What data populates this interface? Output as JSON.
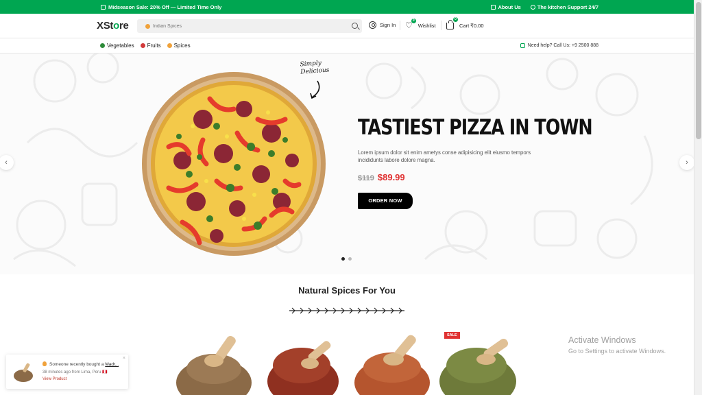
{
  "topbar": {
    "promo_text": "Midseason Sale: 20% Off — Limited Time Only",
    "about_label": "About Us",
    "support_label": "The kitchen Support 24/7"
  },
  "header": {
    "logo_main": "XSt",
    "logo_accent": "o",
    "logo_end": "re",
    "search_placeholder": "Indian Spices",
    "signin_label": "Sign In",
    "wishlist_label": "Wishlist",
    "wishlist_count": "0",
    "cart_label": "Cart",
    "cart_amount": "₹0.00",
    "cart_count": "0"
  },
  "nav": {
    "categories": [
      {
        "label": "Vegetables",
        "color": "#2e8b3a"
      },
      {
        "label": "Fruits",
        "color": "#d23b3b"
      },
      {
        "label": "Spices",
        "color": "#f0a23b"
      }
    ],
    "help_text": "Need help? Call Us: +9 2500 888"
  },
  "hero": {
    "handwritten_line1": "Simply",
    "handwritten_line2": "Delicious",
    "title": "TASTIEST PIZZA IN TOWN",
    "description": "Lorem ipsum dolor sit enim ametys conse adipisicing elit eiusmo tempors incididunts labore dolore magna.",
    "old_price": "$119",
    "new_price": "$89.99",
    "cta_label": "ORDER NOW",
    "slides_total": 2,
    "active_slide": 1
  },
  "section": {
    "title": "Natural Spices For You"
  },
  "products": [
    {
      "name": "cumin-powder",
      "color": "#8b6a47",
      "sale": false
    },
    {
      "name": "chili-flakes",
      "color": "#9b3a23",
      "sale": false
    },
    {
      "name": "paprika-powder",
      "color": "#b5552e",
      "sale": false
    },
    {
      "name": "dried-herbs",
      "color": "#6e7a3a",
      "sale": true,
      "badge": "SALE"
    }
  ],
  "notification": {
    "line1_prefix": "Someone recently bought a",
    "line1_product": "Madr...",
    "line2": "38 minutes ago from Lima, Peru 🇵🇪",
    "link_label": "View Product",
    "close_glyph": "×"
  },
  "os_overlay": {
    "line1": "Activate Windows",
    "line2": "Go to Settings to activate Windows."
  },
  "colors": {
    "brand_green": "#00a651",
    "price_red": "#e03232",
    "cta_black": "#000000"
  }
}
